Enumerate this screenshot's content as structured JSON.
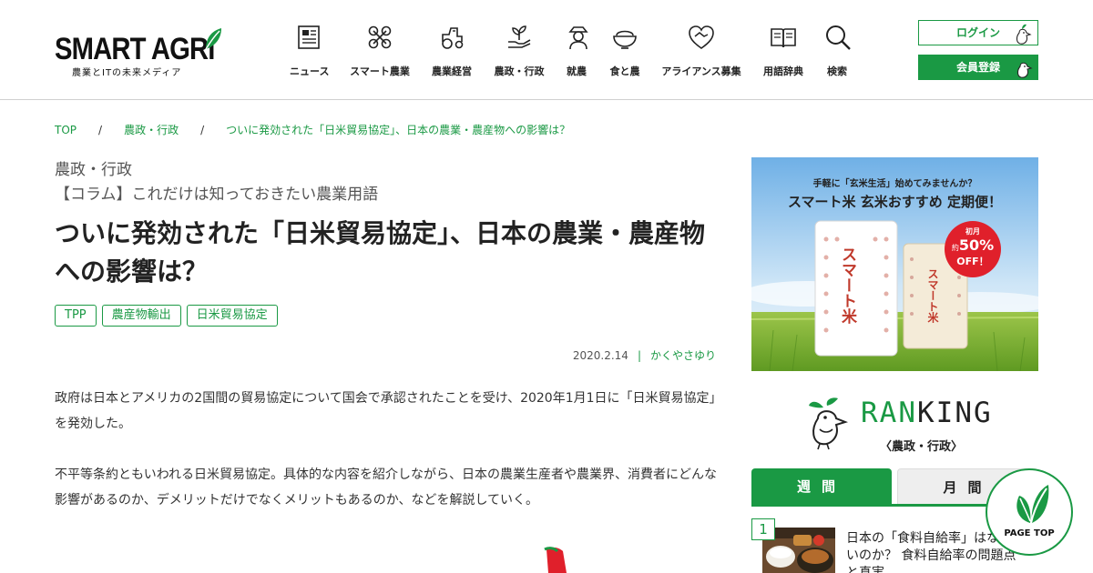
{
  "header": {
    "logo_text": "SMART AGRI",
    "logo_tagline": "農業とITの未来メディア",
    "nav": [
      {
        "label": "ニュース",
        "icon": "newspaper-icon"
      },
      {
        "label": "スマート農業",
        "icon": "drone-icon"
      },
      {
        "label": "農業経営",
        "icon": "tractor-icon"
      },
      {
        "label": "農政・行政",
        "icon": "sprout-hand-icon"
      },
      {
        "label": "就農",
        "icon": "farmer-icon"
      },
      {
        "label": "食と農",
        "icon": "rice-bowl-icon"
      },
      {
        "label": "アライアンス募集",
        "icon": "handshake-heart-icon"
      },
      {
        "label": "用語辞典",
        "icon": "open-book-icon"
      },
      {
        "label": "検索",
        "icon": "search-icon"
      }
    ],
    "login_label": "ログイン",
    "register_label": "会員登録"
  },
  "breadcrumb": {
    "items": [
      "TOP",
      "農政・行政",
      "ついに発効された「日米貿易協定」、日本の農業・農産物への影響は？"
    ],
    "separator": "/"
  },
  "article": {
    "category": "農政・行政",
    "series": "【コラム】これだけは知っておきたい農業用語",
    "title": "ついに発効された「日米貿易協定」、日本の農業・農産物への影響は？",
    "tags": [
      "TPP",
      "農産物輸出",
      "日米貿易協定"
    ],
    "date": "2020.2.14",
    "meta_separator": "|",
    "author": "かくやさゆり",
    "paragraphs": [
      "政府は日本とアメリカの2国間の貿易協定について国会で承認されたことを受け、2020年1月1日に「日米貿易協定」を発効した。",
      "不平等条約ともいわれる日米貿易協定。具体的な内容を紹介しながら、日本の農業生産者や農業界、消費者にどんな影響があるのか、デメリットだけでなくメリットもあるのか、などを解説していく。"
    ]
  },
  "sidebar": {
    "ad": {
      "lead": "手軽に「玄米生活」始めてみませんか？",
      "headline": "スマート米 玄米おすすめ 定期便！",
      "badge_top": "初月",
      "badge_prefix": "約",
      "badge_value": "50%",
      "badge_bottom": "OFF！",
      "bag_label": "スマート米"
    },
    "ranking": {
      "title_accent": "RAN",
      "title_rest": "KING",
      "subtitle": "〈農政・行政〉",
      "tab_weekly": "週間",
      "tab_monthly": "月間",
      "items": [
        {
          "rank": "1",
          "text": "日本の「食料自給率」はなぜ低いのか？ 食料自給率の問題点と真実"
        }
      ]
    },
    "page_top_label": "PAGE TOP"
  },
  "colors": {
    "brand_green": "#1a9944",
    "badge_red": "#e0202b",
    "text_dark": "#222222"
  }
}
